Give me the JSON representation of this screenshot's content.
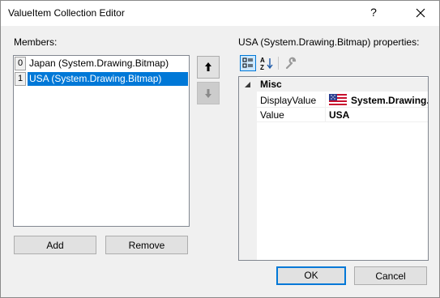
{
  "window": {
    "title": "ValueItem Collection Editor",
    "help_label": "?",
    "close_icon": "close-icon"
  },
  "members": {
    "label": "Members:",
    "items": [
      {
        "index": "0",
        "text": "Japan (System.Drawing.Bitmap)",
        "selected": false
      },
      {
        "index": "1",
        "text": "USA (System.Drawing.Bitmap)",
        "selected": true
      }
    ],
    "add_label": "Add",
    "remove_label": "Remove",
    "move_up_icon": "arrow-up-icon",
    "move_down_icon": "arrow-down-icon"
  },
  "properties": {
    "label": "USA (System.Drawing.Bitmap) properties:",
    "toolbar": {
      "categorized_icon": "categorized-icon",
      "alphabetical_icon": "alphabetical-icon",
      "property_pages_icon": "wrench-icon"
    },
    "category": "Misc",
    "rows": [
      {
        "name": "DisplayValue",
        "value": "System.Drawing.",
        "icon": "us-flag-icon"
      },
      {
        "name": "Value",
        "value": "USA"
      }
    ]
  },
  "footer": {
    "ok_label": "OK",
    "cancel_label": "Cancel"
  },
  "colors": {
    "selection": "#0078d7",
    "window_bg": "#f0f0f0"
  }
}
